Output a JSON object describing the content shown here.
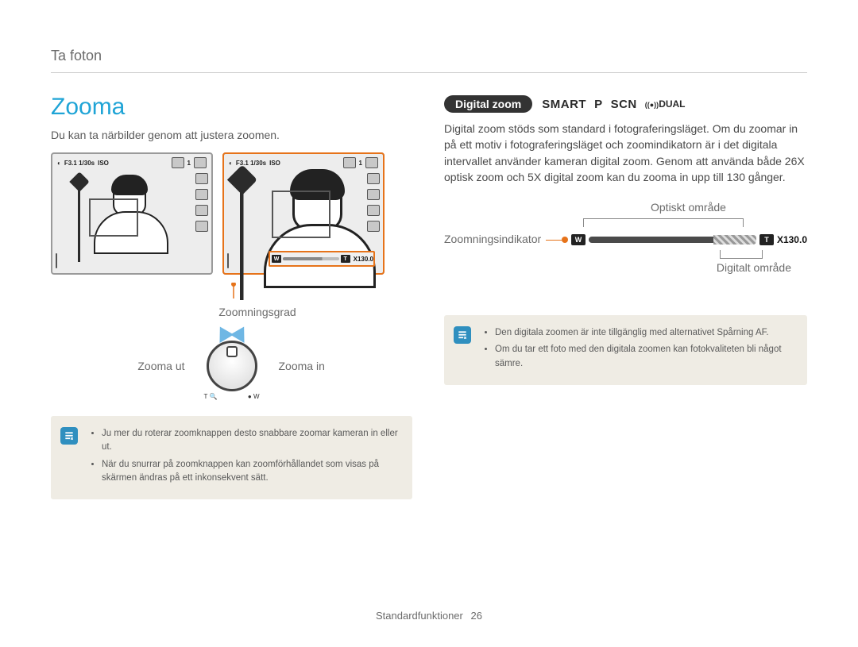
{
  "breadcrumb": "Ta foton",
  "heading": "Zooma",
  "intro": "Du kan ta närbilder genom att justera zoomen.",
  "lcd_overlay": {
    "exposure": "F3.1  1/30s",
    "iso": "ISO",
    "count": "1",
    "zoom_w": "W",
    "zoom_t": "T",
    "zoom_value": "X130.0"
  },
  "labels": {
    "zoomningsgrad": "Zoomningsgrad",
    "zooma_ut": "Zooma ut",
    "zooma_in": "Zooma in",
    "knob_t": "T",
    "knob_w": "W"
  },
  "note_left": {
    "items": [
      "Ju mer du roterar zoomknappen desto snabbare zoomar kameran in eller ut.",
      "När du snurrar på zoomknappen kan zoomförhållandet som visas på skärmen ändras på ett inkonsekvent sätt."
    ]
  },
  "right": {
    "pill": "Digital zoom",
    "modes": {
      "smart": "SMART",
      "p": "P",
      "scn": "SCN",
      "dual": "DUAL"
    },
    "para": "Digital zoom stöds som standard i fotograferingsläget. Om du zoomar in på ett motiv i fotograferingsläget och zoomindikatorn är i det digitala intervallet använder kameran digital zoom. Genom att använda både 26X optisk zoom och 5X digital zoom kan du zooma in upp till 130 gånger.",
    "optiskt": "Optiskt område",
    "zoom_indikator": "Zoomningsindikator",
    "digitalt": "Digitalt område",
    "bar_w": "W",
    "bar_t": "T",
    "bar_value": "X130.0"
  },
  "note_right": {
    "items": [
      "Den digitala zoomen är inte tillgänglig med alternativet Spårning AF.",
      "Om du tar ett foto med den digitala zoomen kan fotokvaliteten bli något sämre."
    ]
  },
  "footer": {
    "section": "Standardfunktioner",
    "page": "26"
  }
}
